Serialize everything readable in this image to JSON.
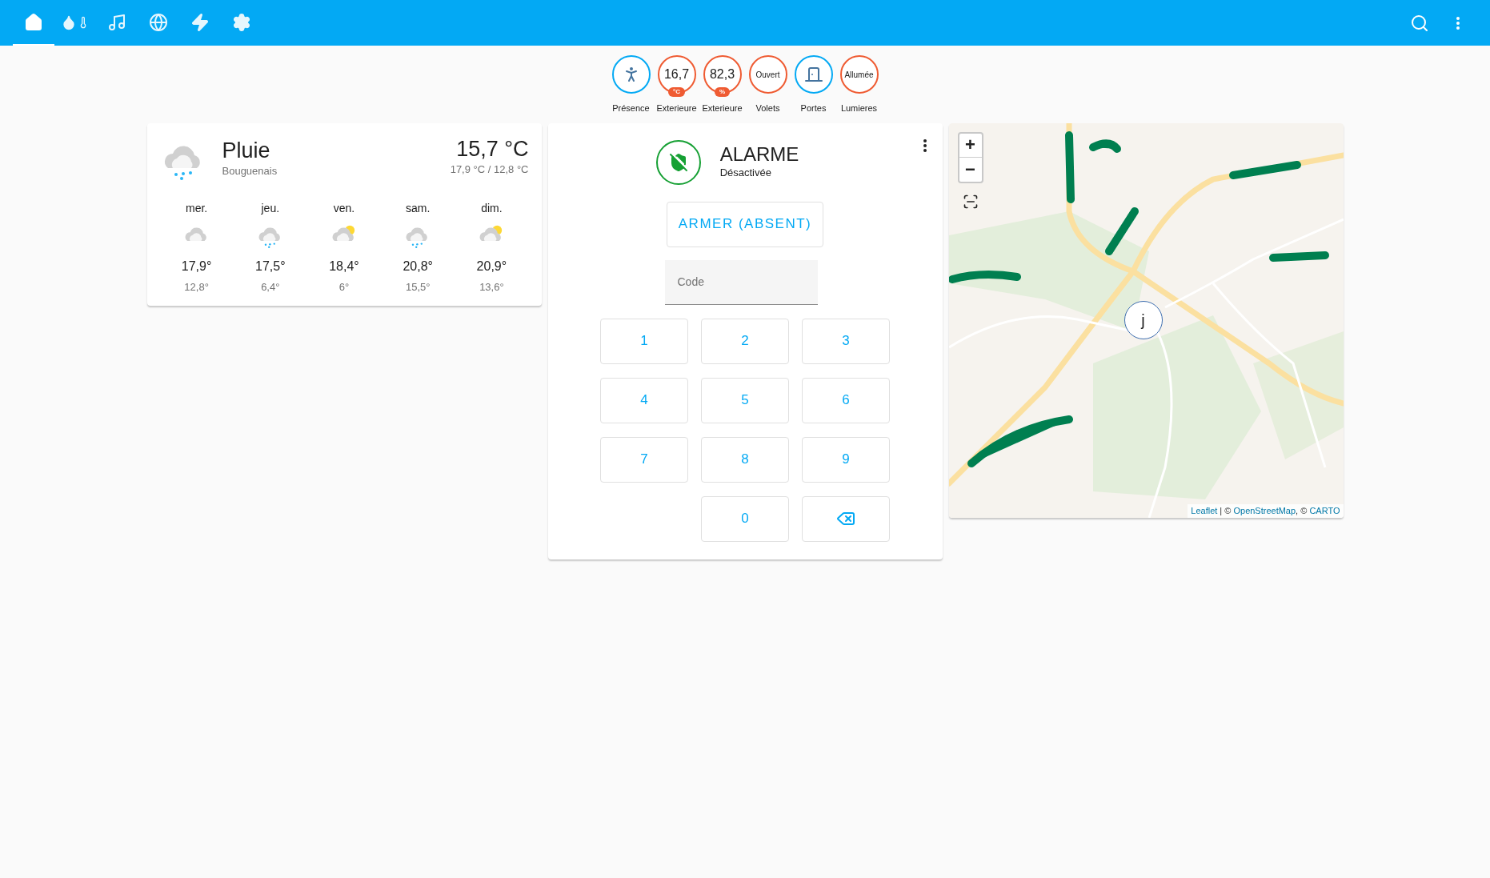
{
  "toolbar": {
    "tabs": [
      {
        "kind": "home",
        "selected": true
      },
      {
        "kind": "water-thermometer",
        "selected": false
      },
      {
        "kind": "music",
        "selected": false
      },
      {
        "kind": "globe",
        "selected": false
      },
      {
        "kind": "flash",
        "selected": false
      },
      {
        "kind": "settings",
        "selected": false
      }
    ]
  },
  "badges": [
    {
      "kind": "presence",
      "label": "Présence",
      "color": "#03a9f4"
    },
    {
      "kind": "value",
      "value": "16,7",
      "unit": "°C",
      "label": "Exterieure",
      "color": "#ef5b32"
    },
    {
      "kind": "value",
      "value": "82,3",
      "unit": "%",
      "label": "Exterieure",
      "color": "#ef5b32"
    },
    {
      "kind": "state",
      "value": "Ouvert",
      "label": "Volets",
      "color": "#ef5b32"
    },
    {
      "kind": "door",
      "label": "Portes",
      "color": "#03a9f4"
    },
    {
      "kind": "state",
      "value": "Allumée",
      "label": "Lumieres",
      "color": "#ef5b32"
    }
  ],
  "weather": {
    "condition": "Pluie",
    "kind": "rainy",
    "location": "Bouguenais",
    "temperature": "15,7 °C",
    "range": "17,9 °C / 12,8 °C",
    "forecast": [
      {
        "day": "mer.",
        "kind": "cloudy",
        "high": "17,9°",
        "low": "12,8°"
      },
      {
        "day": "jeu.",
        "kind": "rainy",
        "high": "17,5°",
        "low": "6,4°"
      },
      {
        "day": "ven.",
        "kind": "partly-sunny",
        "high": "18,4°",
        "low": "6°"
      },
      {
        "day": "sam.",
        "kind": "rainy",
        "high": "20,8°",
        "low": "15,5°"
      },
      {
        "day": "dim.",
        "kind": "partly-sunny",
        "high": "20,9°",
        "low": "13,6°"
      }
    ]
  },
  "alarm": {
    "title": "ALARME",
    "state": "Désactivée",
    "armed": false,
    "action": "ARMER (ABSENT)",
    "code": {
      "placeholder": "Code"
    },
    "keys": [
      {
        "kind": "digit",
        "label": "1"
      },
      {
        "kind": "digit",
        "label": "2"
      },
      {
        "kind": "digit",
        "label": "3"
      },
      {
        "kind": "digit",
        "label": "4"
      },
      {
        "kind": "digit",
        "label": "5"
      },
      {
        "kind": "digit",
        "label": "6"
      },
      {
        "kind": "digit",
        "label": "7"
      },
      {
        "kind": "digit",
        "label": "8"
      },
      {
        "kind": "digit",
        "label": "9"
      },
      {
        "kind": "spacer"
      },
      {
        "kind": "digit",
        "label": "0"
      },
      {
        "kind": "backspace"
      }
    ]
  },
  "map": {
    "zoom_in": "+",
    "zoom_out": "−",
    "marker": "j",
    "attribution": [
      {
        "kind": "link",
        "text": "Leaflet"
      },
      {
        "kind": "text",
        "text": " | © "
      },
      {
        "kind": "link",
        "text": "OpenStreetMap"
      },
      {
        "kind": "text",
        "text": ", © "
      },
      {
        "kind": "link",
        "text": "CARTO"
      }
    ]
  }
}
